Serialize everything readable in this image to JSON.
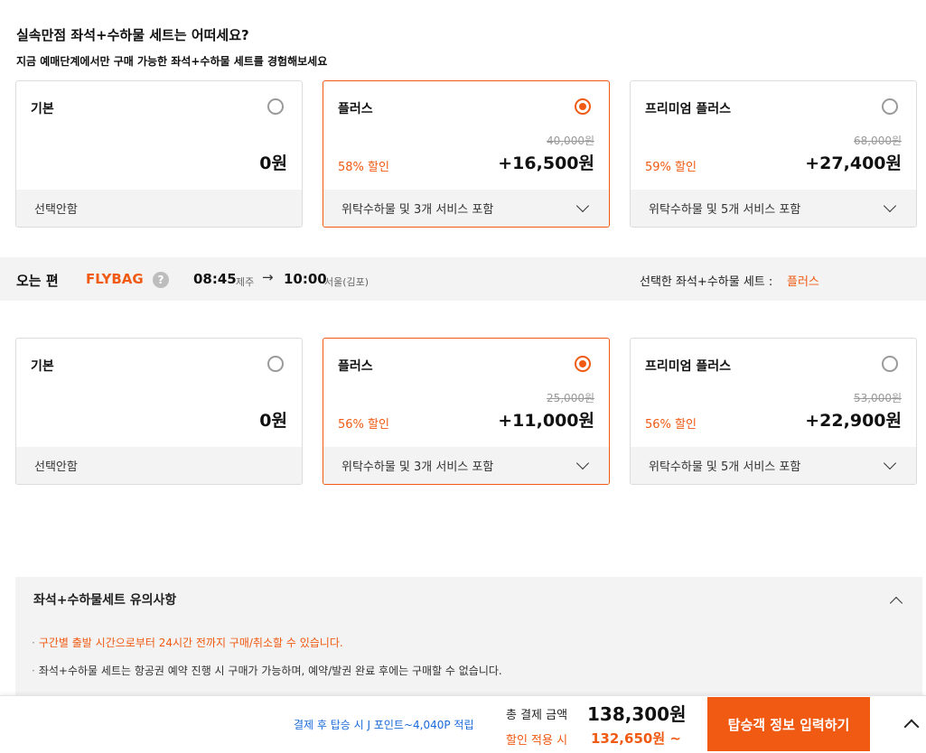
{
  "heading": {
    "title": "실속만점 좌석+수하물 세트는 어떠세요?",
    "subtitle": "지금 예매단계에서만 구매 가능한 좌석+수하물 세트를 경험해보세요"
  },
  "outbound": {
    "options": [
      {
        "name": "기본",
        "original": "",
        "discount": "",
        "price": "0원",
        "desc": "선택안함",
        "selected": false
      },
      {
        "name": "플러스",
        "original": "40,000원",
        "discount": "58% 할인",
        "price": "+16,500원",
        "desc": "위탁수하물 및 3개 서비스 포함",
        "selected": true
      },
      {
        "name": "프리미엄 플러스",
        "original": "68,000원",
        "discount": "59% 할인",
        "price": "+27,400원",
        "desc": "위탁수하물 및 5개 서비스 포함",
        "selected": false
      }
    ]
  },
  "return_flight": {
    "direction": "오는 편",
    "brand": "FLYBAG",
    "help": "?",
    "depart_time": "08:45",
    "depart_city": "제주",
    "arrow": "→",
    "arrive_time": "10:00",
    "arrive_city": "서울(김포)",
    "selected_label": "선택한 좌석+수하물 세트 :",
    "selected_value": "플러스",
    "options": [
      {
        "name": "기본",
        "original": "",
        "discount": "",
        "price": "0원",
        "desc": "선택안함",
        "selected": false
      },
      {
        "name": "플러스",
        "original": "25,000원",
        "discount": "56% 할인",
        "price": "+11,000원",
        "desc": "위탁수하물 및 3개 서비스 포함",
        "selected": true
      },
      {
        "name": "프리미엄 플러스",
        "original": "53,000원",
        "discount": "56% 할인",
        "price": "+22,900원",
        "desc": "위탁수하물 및 5개 서비스 포함",
        "selected": false
      }
    ]
  },
  "notice": {
    "title": "좌석+수하물세트 유의사항",
    "items": [
      "구간별 출발 시간으로부터 24시간 전까지 구매/취소할 수 있습니다.",
      "좌석+수하물 세트는 항공권 예약 진행 시 구매가 가능하며, 예약/발권 완료 후에는 구매할 수 없습니다."
    ]
  },
  "footer": {
    "points": "결제 후 탑승 시 J 포인트~4,040P 적립",
    "total_label": "총 결제 금액",
    "total_value": "138,300원",
    "discount_label": "할인 적용 시",
    "discount_value": "132,650원 ~",
    "cta": "탑승객 정보 입력하기"
  },
  "colors": {
    "accent": "#f05a12",
    "link": "#1a6ad9",
    "band": "#f3f3f3"
  },
  "icons": [
    "radio-icon",
    "chevron-down-icon",
    "help-icon",
    "arrow-right-icon",
    "chevron-up-icon"
  ]
}
